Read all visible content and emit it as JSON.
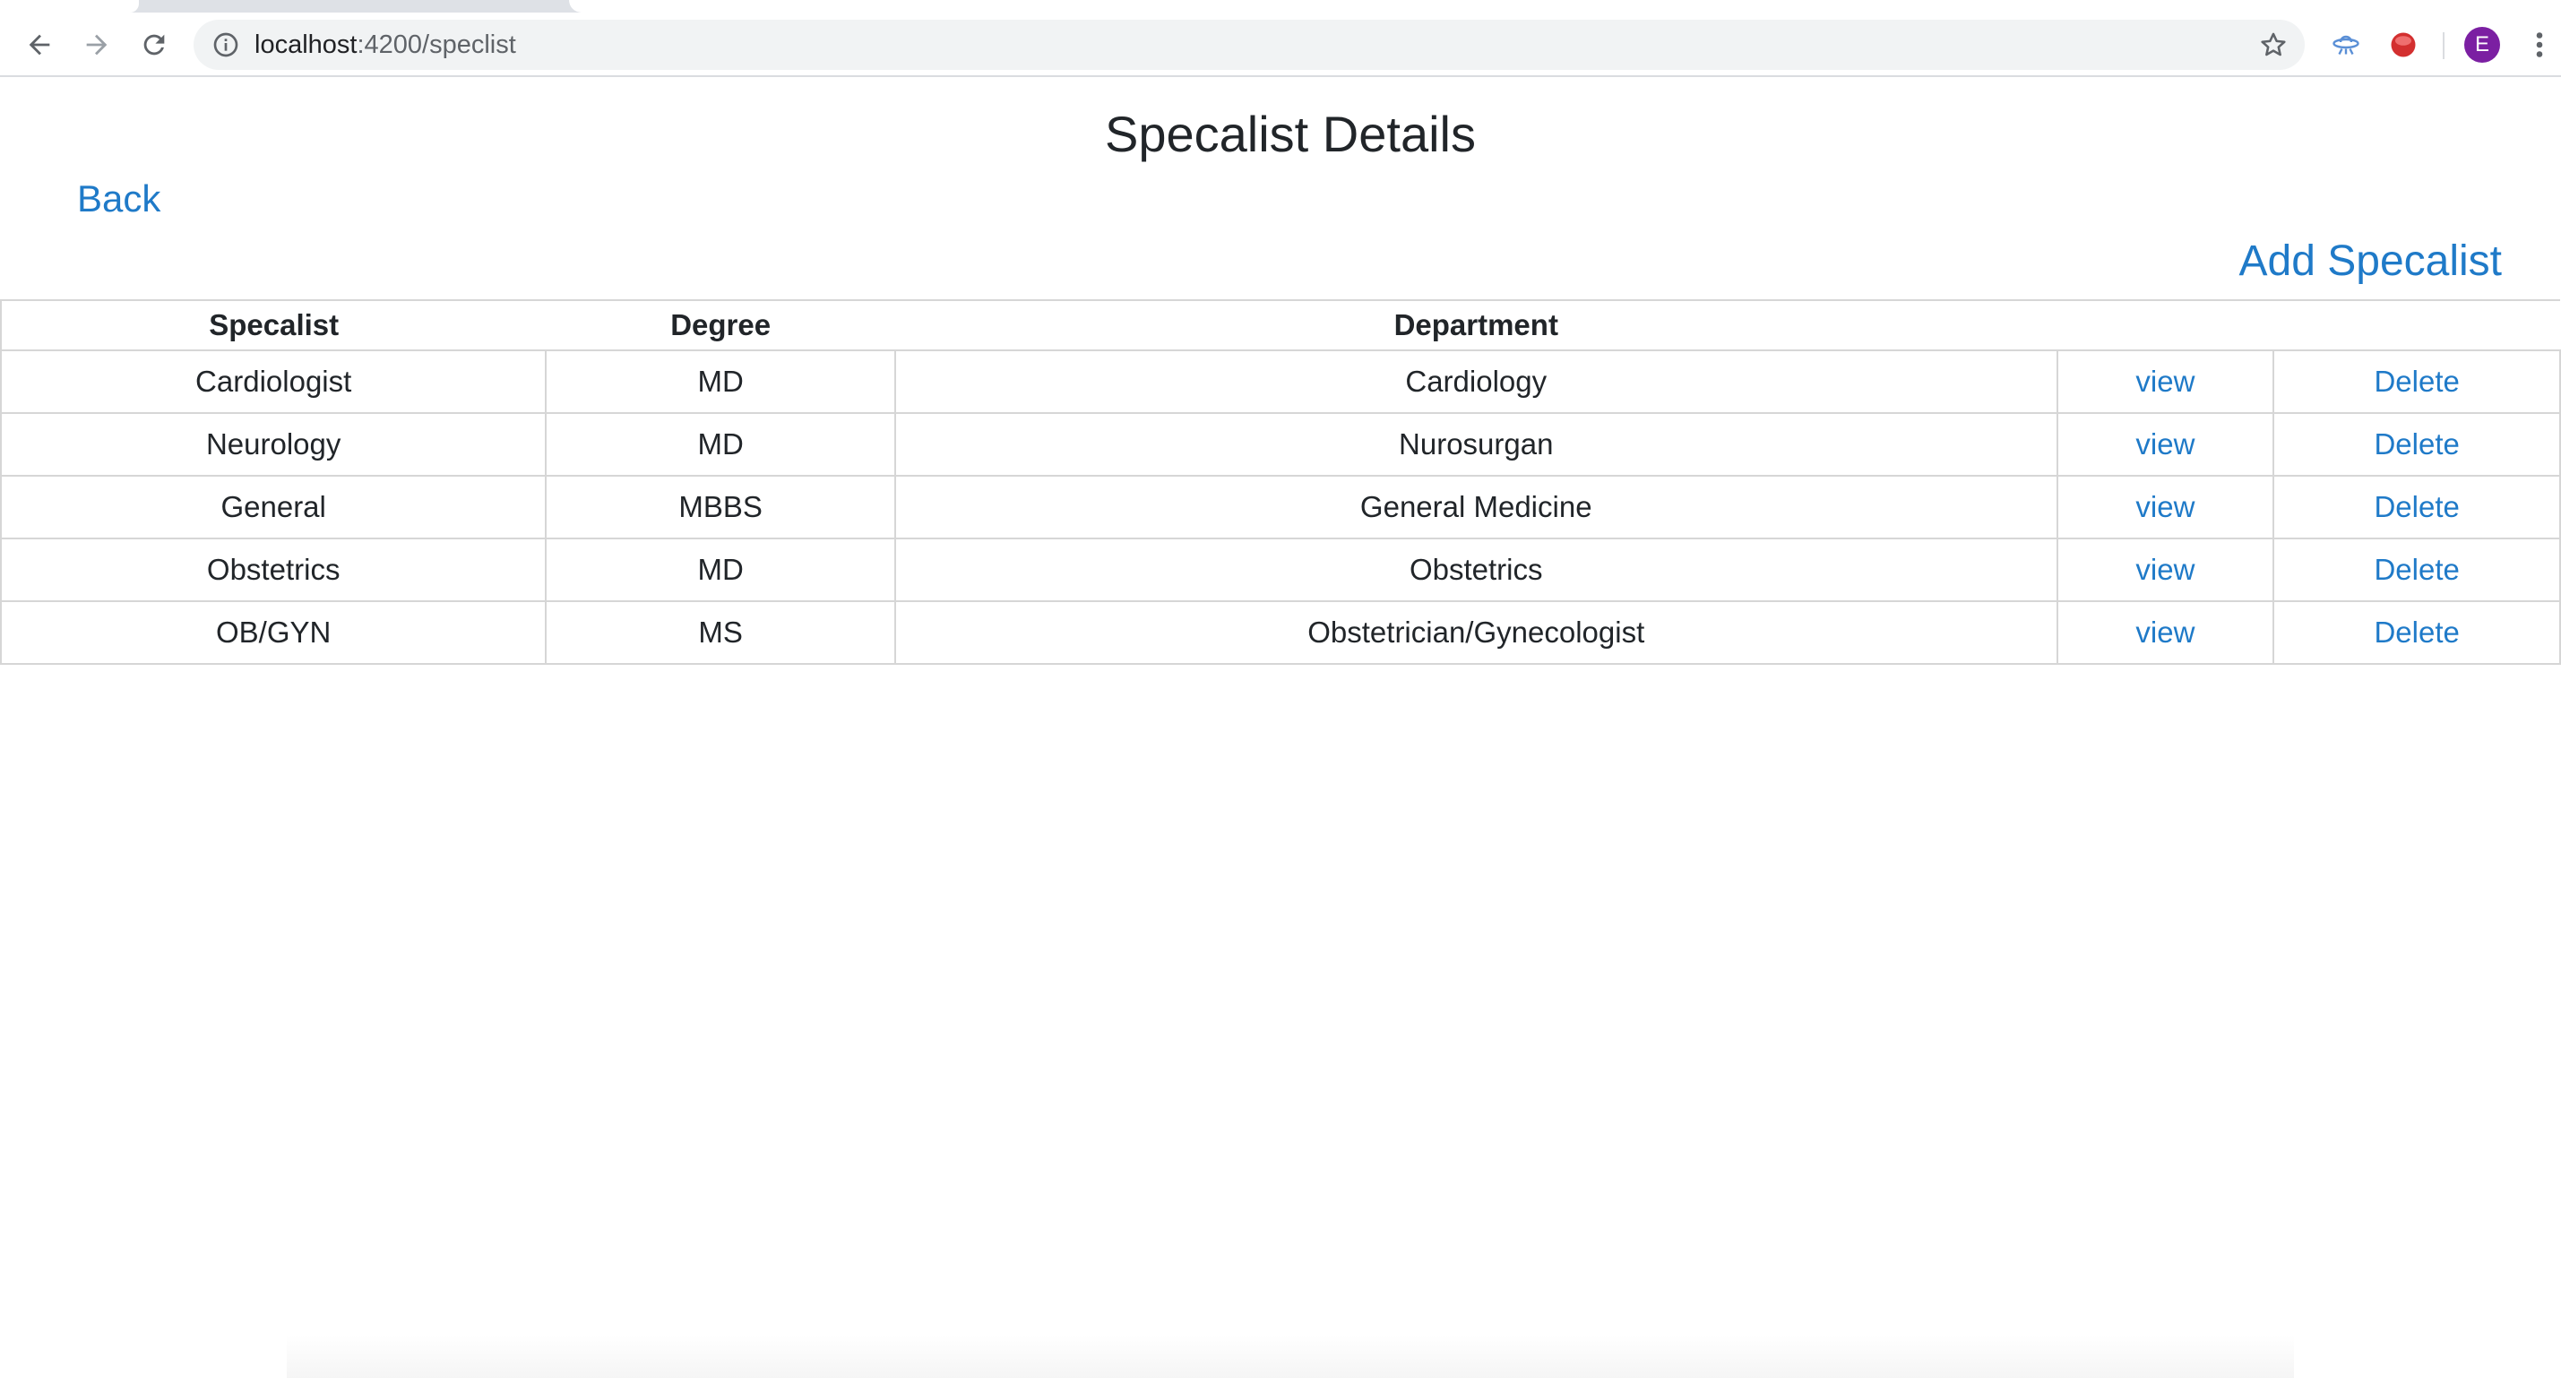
{
  "browser": {
    "url_host": "localhost",
    "url_path": ":4200/speclist",
    "profile_initial": "E"
  },
  "page": {
    "title": "Specalist Details",
    "back_label": "Back",
    "add_label": "Add Specalist"
  },
  "table": {
    "headers": [
      "Specalist",
      "Degree",
      "Department",
      "",
      ""
    ],
    "rows": [
      {
        "specialist": "Cardiologist",
        "degree": "MD",
        "department": "Cardiology",
        "view": "view",
        "delete": "Delete"
      },
      {
        "specialist": "Neurology",
        "degree": "MD",
        "department": "Nurosurgan",
        "view": "view",
        "delete": "Delete"
      },
      {
        "specialist": "General",
        "degree": "MBBS",
        "department": "General Medicine",
        "view": "view",
        "delete": "Delete"
      },
      {
        "specialist": "Obstetrics",
        "degree": "MD",
        "department": "Obstetrics",
        "view": "view",
        "delete": "Delete"
      },
      {
        "specialist": "OB/GYN",
        "degree": "MS",
        "department": "Obstetrician/Gynecologist",
        "view": "view",
        "delete": "Delete"
      }
    ]
  },
  "colors": {
    "link": "#1f7ac8",
    "avatar": "#7b1fa2"
  },
  "icons": [
    "back-arrow-icon",
    "forward-arrow-icon",
    "reload-icon",
    "info-icon",
    "star-icon",
    "extension-ufo-icon",
    "extension-red-dot-icon",
    "kebab-menu-icon"
  ]
}
